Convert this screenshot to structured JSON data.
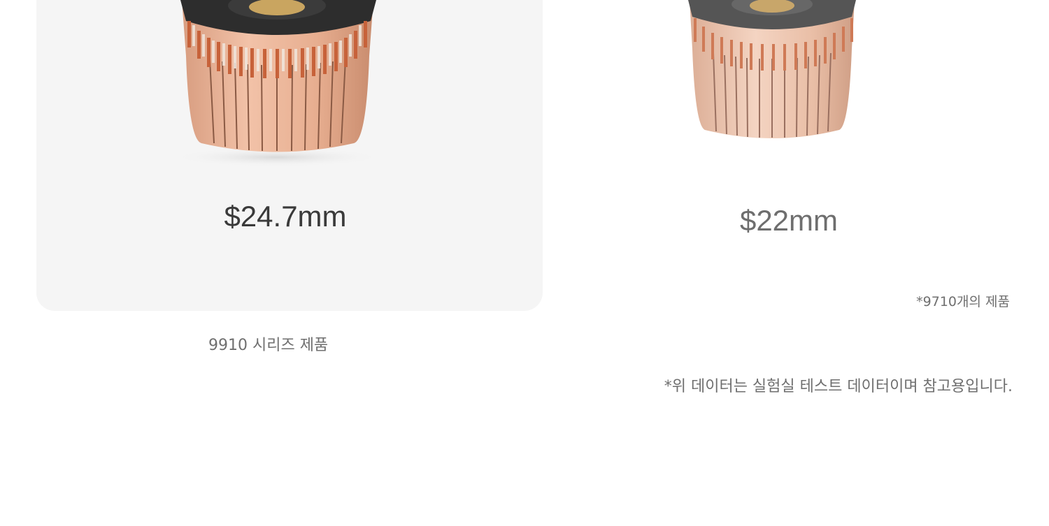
{
  "products": [
    {
      "size_label": "$24.7mm",
      "caption": "9910 시리즈 제품"
    },
    {
      "size_label": "$22mm",
      "caption": "*9710개의 제품"
    }
  ],
  "disclaimer": "*위 데이터는 실험실 테스트 데이터이며 참고용입니다.",
  "colors": {
    "card_bg": "#f5f5f5",
    "copper": "#e6a98a",
    "copper_dark": "#c47e5e",
    "insulator": "#2b2b2b",
    "brass": "#c9a560"
  }
}
